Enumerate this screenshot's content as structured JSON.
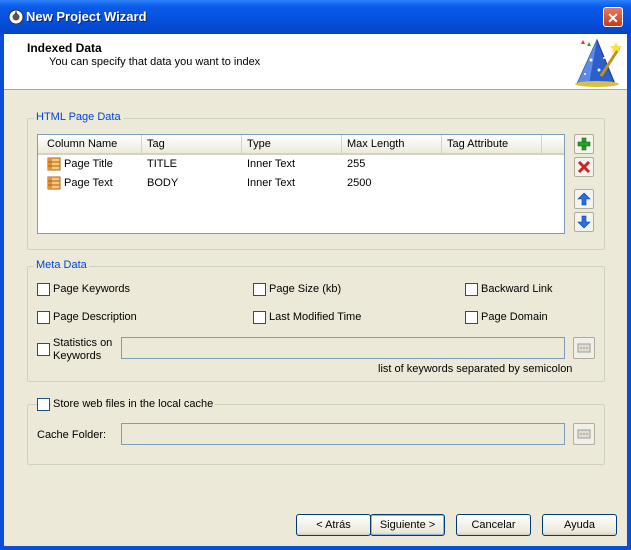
{
  "window": {
    "title": "New Project Wizard",
    "close_glyph": "✕"
  },
  "header": {
    "title": "Indexed Data",
    "subtitle": "You can specify that data you want to index",
    "icon": "wizard-hat-icon"
  },
  "html_page_data": {
    "label": "HTML Page Data",
    "columns": [
      "Column Name",
      "Tag",
      "Type",
      "Max Length",
      "Tag Attribute"
    ],
    "rows": [
      {
        "name": "Page Title",
        "tag": "TITLE",
        "type": "Inner Text",
        "max_length": "255",
        "tag_attribute": ""
      },
      {
        "name": "Page Text",
        "tag": "BODY",
        "type": "Inner Text",
        "max_length": "2500",
        "tag_attribute": ""
      }
    ],
    "buttons": [
      "add-icon",
      "delete-icon",
      "move-up-icon",
      "move-down-icon"
    ]
  },
  "meta_data": {
    "label": "Meta Data",
    "options": {
      "page_keywords": "Page Keywords",
      "page_size": "Page Size (kb)",
      "backward_link": "Backward Link",
      "page_description": "Page Description",
      "last_modified": "Last Modified Time",
      "page_domain": "Page Domain",
      "statistics_line1": "Statistics on",
      "statistics_line2": "Keywords"
    },
    "keywords_hint": "list of keywords separated by semicolon",
    "keywords_value": ""
  },
  "cache": {
    "store_label": "Store web files in the local cache",
    "folder_label": "Cache Folder:",
    "folder_value": ""
  },
  "footer": {
    "back": "< Atrás",
    "next": "Siguiente >",
    "cancel": "Cancelar",
    "help": "Ayuda"
  },
  "colors": {
    "titlebar": "#0550dc",
    "group_label": "#0046d5",
    "dialog_bg": "#ece9d8"
  }
}
